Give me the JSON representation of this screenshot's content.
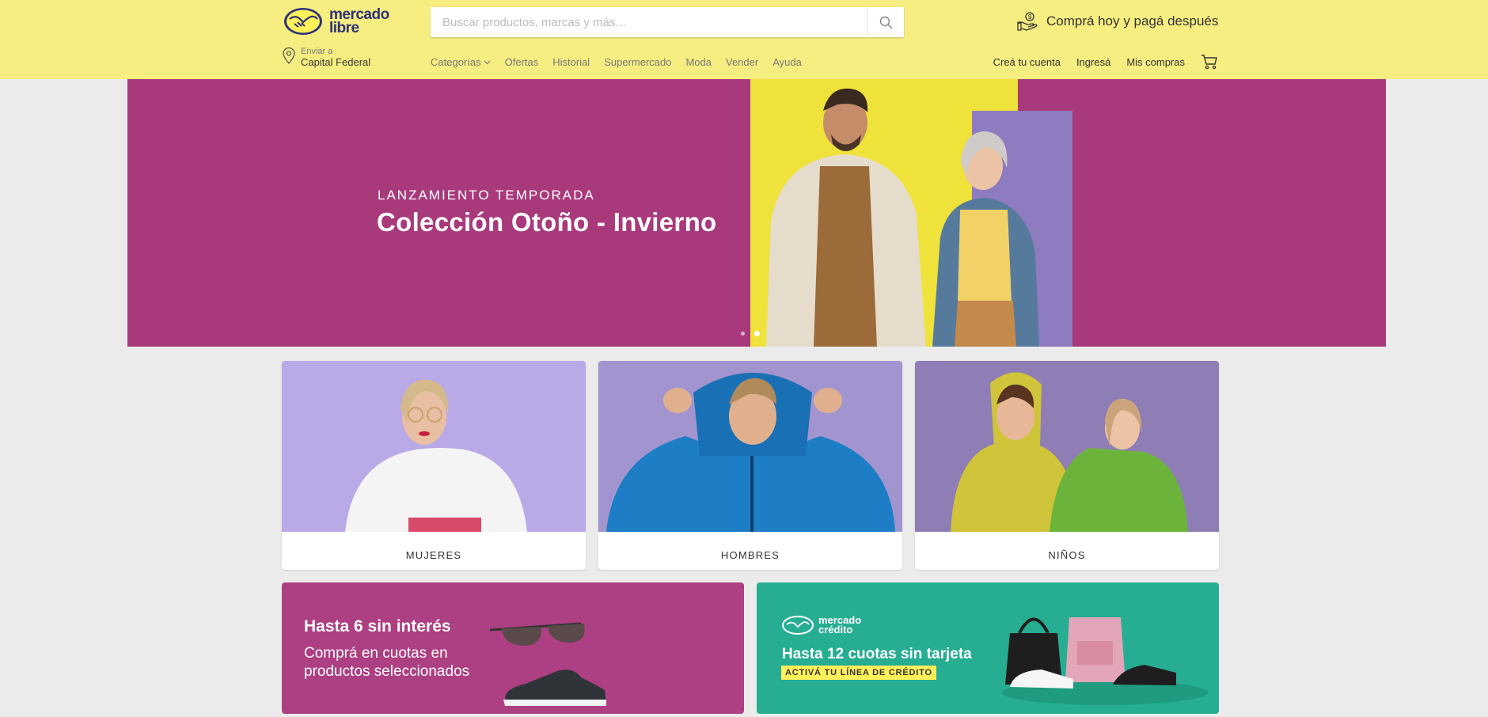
{
  "header": {
    "logo_line1": "mercado",
    "logo_line2": "libre",
    "search_placeholder": "Buscar productos, marcas y más…",
    "promo_text": "Comprá hoy y pagá después",
    "location_label": "Enviar a",
    "location_value": "Capital Federal",
    "nav": [
      "Categorías",
      "Ofertas",
      "Historial",
      "Supermercado",
      "Moda",
      "Vender",
      "Ayuda"
    ],
    "account": [
      "Creá tu cuenta",
      "Ingresá",
      "Mis compras"
    ]
  },
  "hero": {
    "kicker": "LANZAMIENTO TEMPORADA",
    "title": "Colección Otoño - Invierno",
    "slide_count": 2,
    "active_slide": 2
  },
  "cards": [
    {
      "label": "MUJERES"
    },
    {
      "label": "HOMBRES"
    },
    {
      "label": "NIÑOS"
    }
  ],
  "banners": {
    "left": {
      "title": "Hasta 6 sin interés",
      "subtitle": "Comprá en cuotas en productos seleccionados"
    },
    "right": {
      "logo_line1": "mercado",
      "logo_line2": "crédito",
      "title": "Hasta 12 cuotas sin tarjeta",
      "cta": "ACTIVÁ TU LÍNEA DE CRÉDITO"
    }
  },
  "colors": {
    "header_bg": "#f7ee82",
    "hero_bg": "#a83a7c",
    "banner_left_bg": "#ad3f83",
    "banner_right_bg": "#26ad92",
    "cta_bg": "#fff159"
  }
}
